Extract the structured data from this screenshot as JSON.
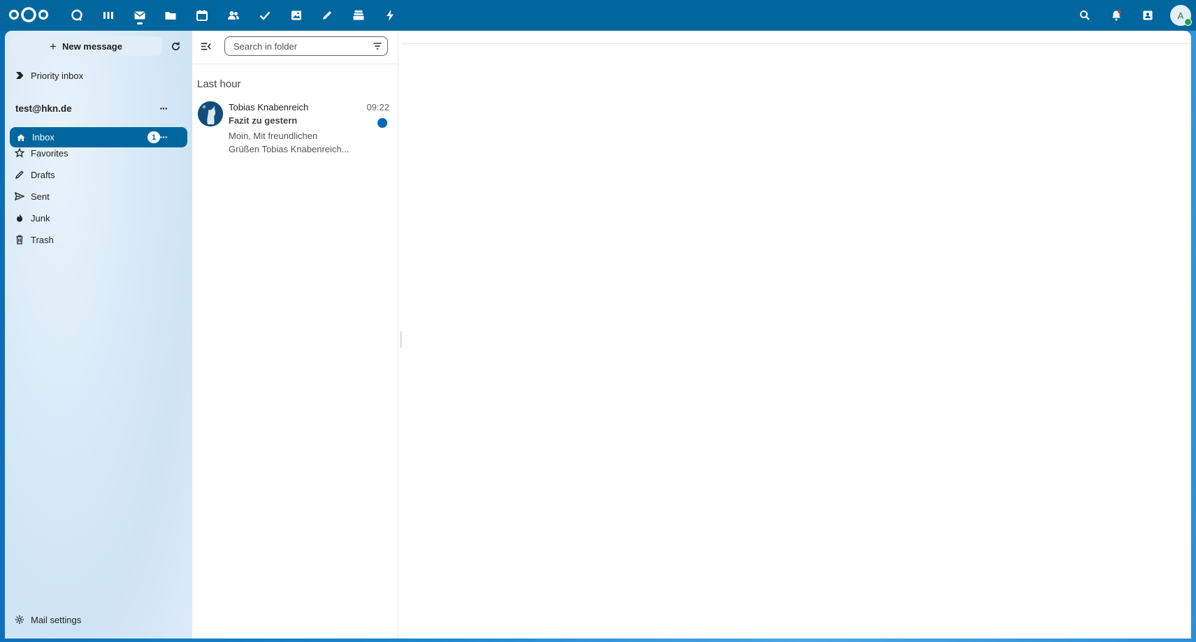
{
  "topbar": {
    "apps": [
      "dashboard-icon",
      "activity-icon",
      "mail-icon",
      "files-icon",
      "calendar-icon",
      "contacts-icon",
      "tasks-icon",
      "photos-icon",
      "notes-icon",
      "deck-icon",
      "flow-icon"
    ],
    "active_app": "mail-icon",
    "user_initial": "A",
    "brand_color": "#00679e"
  },
  "sidebar": {
    "new_message_label": "New message",
    "priority_inbox": "Priority inbox",
    "account": "test@hkn.de",
    "folders": [
      {
        "label": "Inbox",
        "icon": "home-icon",
        "unread": "1",
        "active": true
      },
      {
        "label": "Favorites",
        "icon": "star-icon"
      },
      {
        "label": "Drafts",
        "icon": "pencil-icon"
      },
      {
        "label": "Sent",
        "icon": "send-icon"
      },
      {
        "label": "Junk",
        "icon": "fire-icon"
      },
      {
        "label": "Trash",
        "icon": "trash-icon"
      }
    ],
    "settings_label": "Mail settings"
  },
  "message_list": {
    "search_placeholder": "Search in folder",
    "group_label": "Last hour",
    "messages": [
      {
        "from": "Tobias Knabenreich",
        "time": "09:22",
        "subject": "Fazit zu gestern",
        "preview_line1": "Moin, Mit freundlichen",
        "preview_line2": "Grüßen Tobias Knabenreich...",
        "unread": true
      }
    ]
  }
}
